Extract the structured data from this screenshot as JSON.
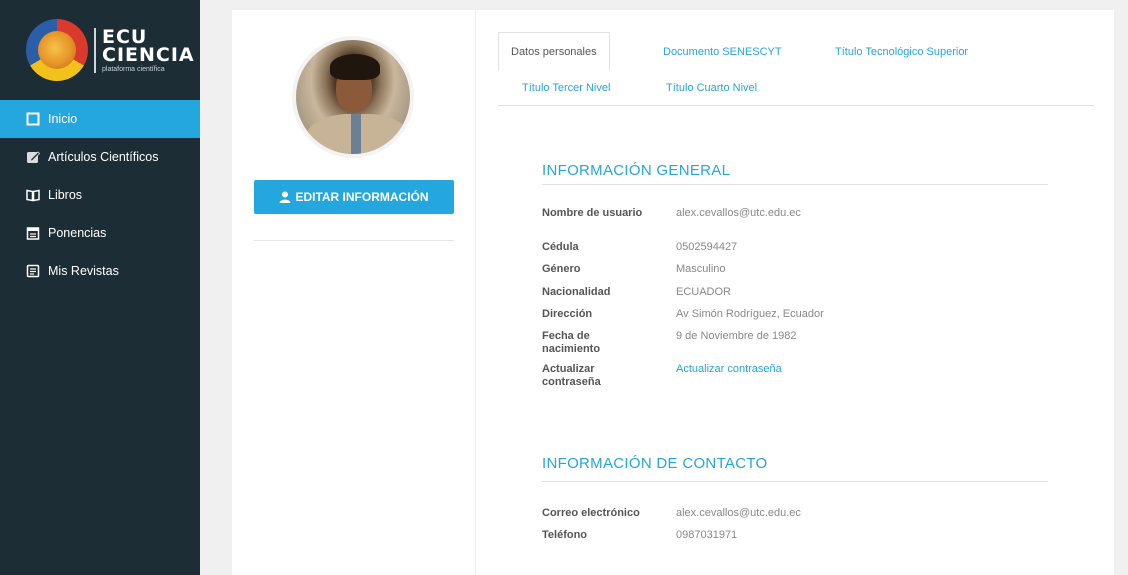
{
  "brand": {
    "line1": "ECU",
    "line2": "CIENCIA",
    "tagline": "plataforma científica"
  },
  "sidebar": {
    "items": [
      {
        "label": "Inicio",
        "icon": "square-icon",
        "active": true
      },
      {
        "label": "Artículos Científicos",
        "icon": "pencil-square-icon"
      },
      {
        "label": "Libros",
        "icon": "book-icon"
      },
      {
        "label": "Ponencias",
        "icon": "calendar-icon"
      },
      {
        "label": "Mis Revistas",
        "icon": "document-icon"
      }
    ]
  },
  "profile": {
    "edit_button": "EDITAR INFORMACIÓN"
  },
  "tabs": [
    {
      "label": "Datos personales",
      "active": true
    },
    {
      "label": "Documento SENESCYT"
    },
    {
      "label": "Título Tecnológico Superior"
    },
    {
      "label": "Título Tercer Nivel"
    },
    {
      "label": "Título Cuarto Nivel"
    }
  ],
  "general": {
    "title": "INFORMACIÓN GENERAL",
    "rows": [
      {
        "label": "Nombre de usuario",
        "value": "alex.cevallos@utc.edu.ec"
      },
      {
        "label": "Cédula",
        "value": "0502594427"
      },
      {
        "label": "Género",
        "value": "Masculino"
      },
      {
        "label": "Nacionalidad",
        "value": "ECUADOR"
      },
      {
        "label": "Dirección",
        "value": "Av Simón Rodríguez, Ecuador"
      },
      {
        "label": "Fecha de nacimiento",
        "value": "9 de Noviembre de 1982"
      },
      {
        "label": "Actualizar contraseña",
        "value": "Actualizar contraseña"
      }
    ]
  },
  "contact": {
    "title": "INFORMACIÓN DE CONTACTO",
    "rows": [
      {
        "label": "Correo electrónico",
        "value": "alex.cevallos@utc.edu.ec"
      },
      {
        "label": "Teléfono",
        "value": "0987031971"
      }
    ]
  },
  "colors": {
    "accent": "#24a6de",
    "sidebar": "#1d2d36",
    "background": "#f0f0f0"
  }
}
